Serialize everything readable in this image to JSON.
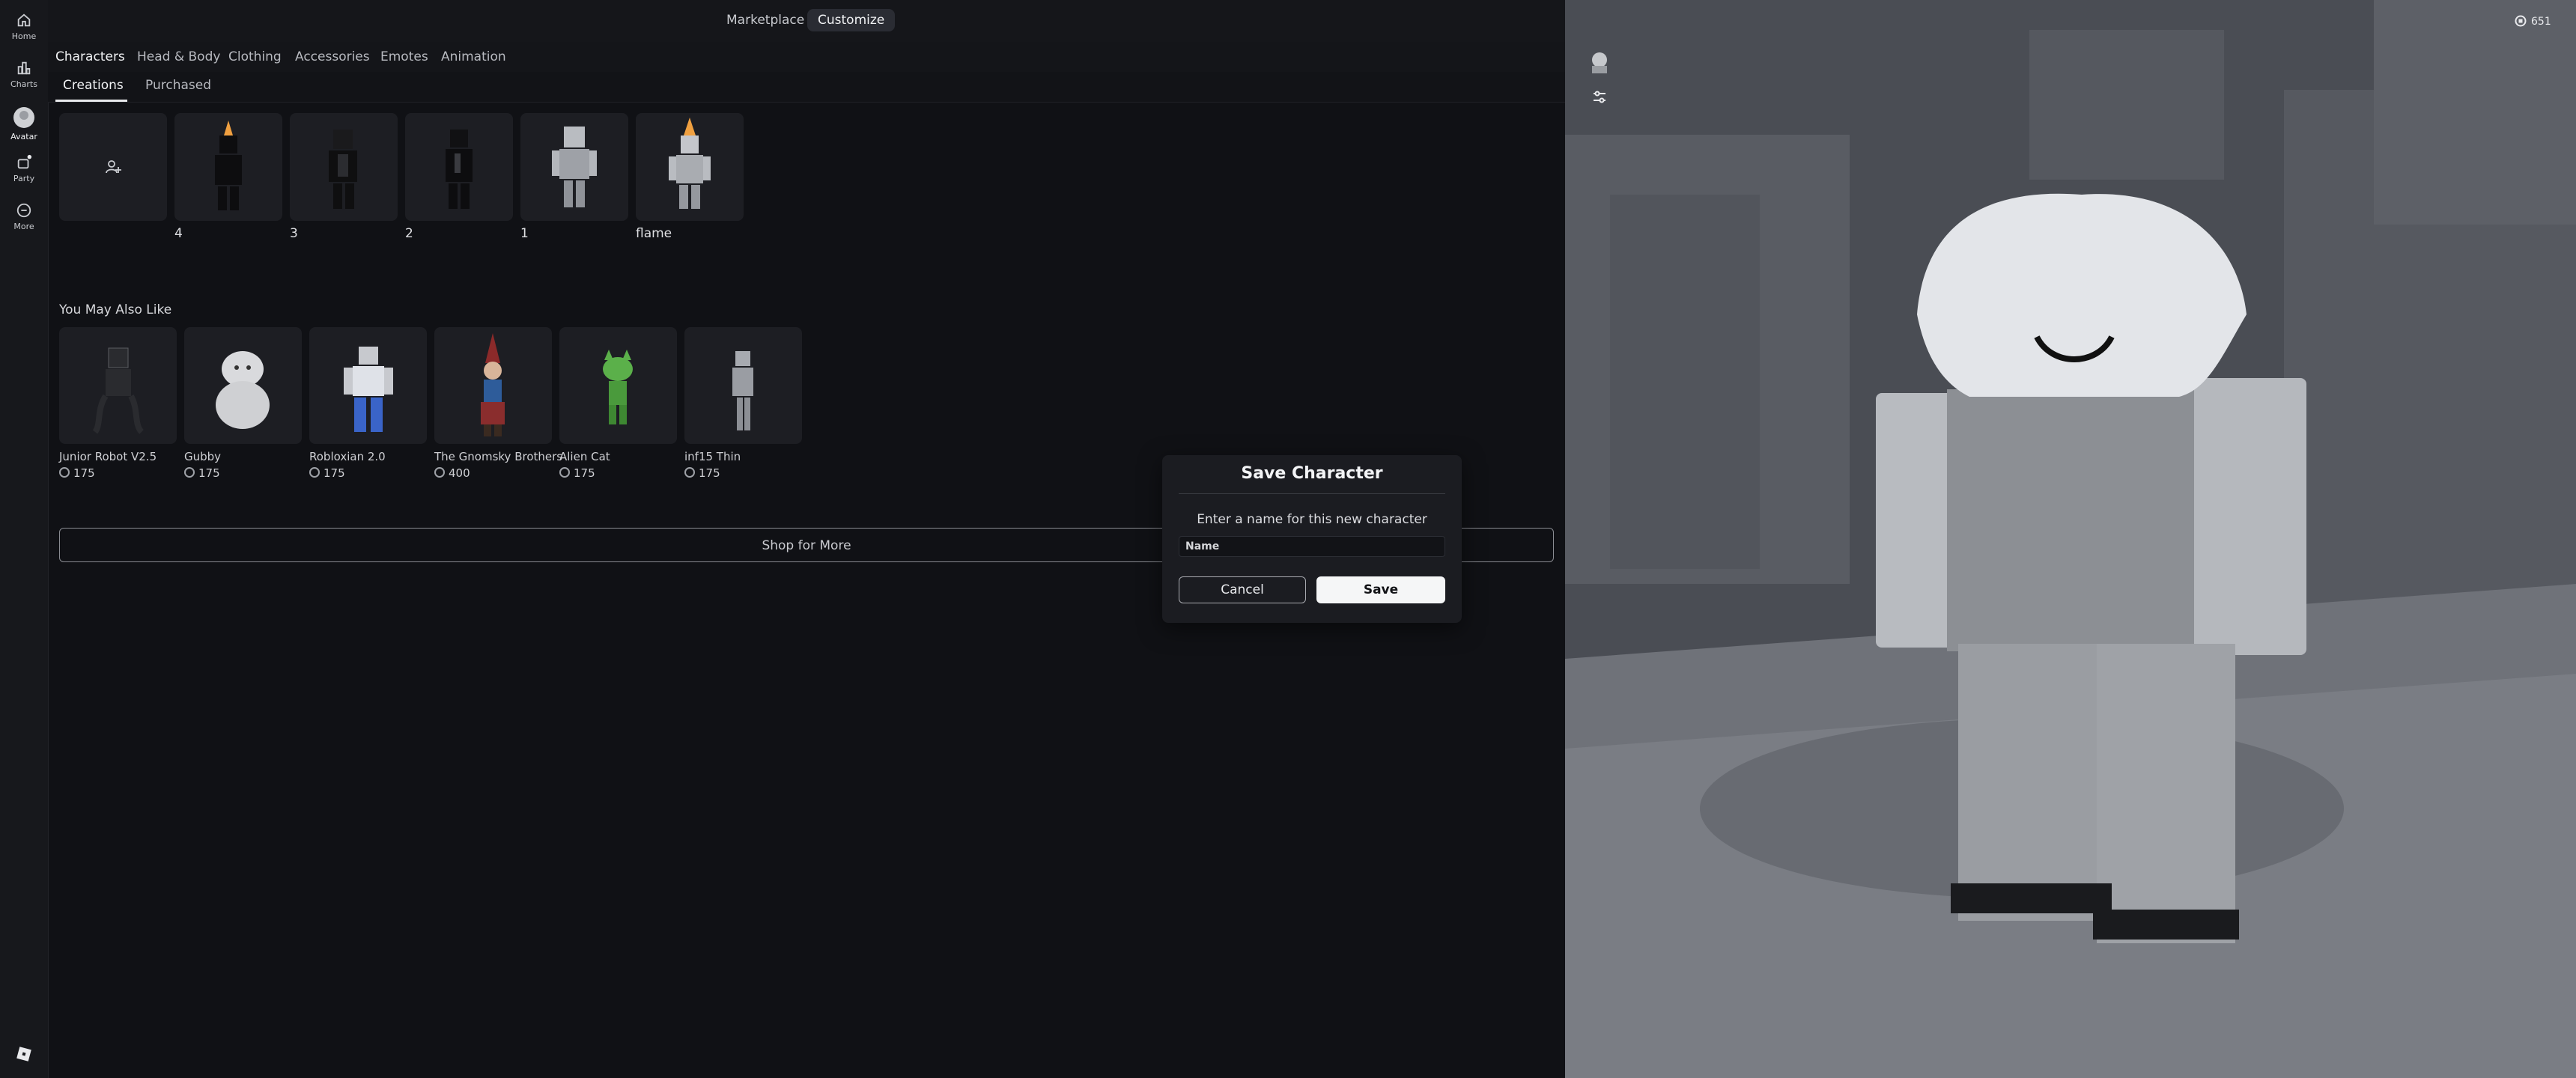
{
  "topbar": {
    "marketplace": "Marketplace",
    "customize": "Customize"
  },
  "sidebar": {
    "items": [
      {
        "label": "Home",
        "icon": "home-icon"
      },
      {
        "label": "Charts",
        "icon": "charts-icon"
      },
      {
        "label": "Avatar",
        "icon": "avatar-icon"
      },
      {
        "label": "Party",
        "icon": "party-icon"
      },
      {
        "label": "More",
        "icon": "more-icon"
      }
    ],
    "logo": "roblox-logo"
  },
  "categories": [
    "Characters",
    "Head & Body",
    "Clothing",
    "Accessories",
    "Emotes",
    "Animation"
  ],
  "subtabs": [
    "Creations",
    "Purchased"
  ],
  "characters": [
    "4",
    "3",
    "2",
    "1",
    "flame"
  ],
  "recommend": {
    "title": "You May Also Like",
    "items": [
      {
        "name": "Junior Robot V2.5",
        "price": "175"
      },
      {
        "name": "Gubby",
        "price": "175"
      },
      {
        "name": "Robloxian 2.0",
        "price": "175"
      },
      {
        "name": "The Gnomsky Brothers",
        "price": "400"
      },
      {
        "name": "Alien Cat",
        "price": "175"
      },
      {
        "name": "inf15 Thin",
        "price": "175"
      }
    ]
  },
  "shop_button": "Shop for More",
  "modal": {
    "title": "Save Character",
    "prompt": "Enter a name for this new character",
    "placeholder": "Name",
    "cancel": "Cancel",
    "save": "Save"
  },
  "viewport": {
    "currency": "651"
  },
  "colors": {
    "background": "#101115",
    "accent": "#f5f6f7"
  }
}
